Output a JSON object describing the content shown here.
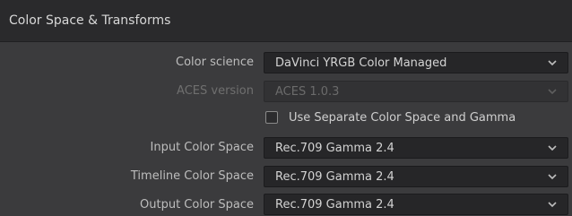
{
  "panel": {
    "title": "Color Space & Transforms"
  },
  "rows": {
    "color_science": {
      "label": "Color science",
      "value": "DaVinci YRGB Color Managed"
    },
    "aces_version": {
      "label": "ACES version",
      "value": "ACES 1.0.3"
    },
    "separate_checkbox": {
      "label": "Use Separate Color Space and Gamma",
      "checked": false
    },
    "input_color_space": {
      "label": "Input Color Space",
      "value": "Rec.709 Gamma 2.4"
    },
    "timeline_color_space": {
      "label": "Timeline Color Space",
      "value": "Rec.709 Gamma 2.4"
    },
    "output_color_space": {
      "label": "Output Color Space",
      "value": "Rec.709 Gamma 2.4"
    }
  },
  "icons": {
    "dropdown": "chevron-down-icon"
  }
}
